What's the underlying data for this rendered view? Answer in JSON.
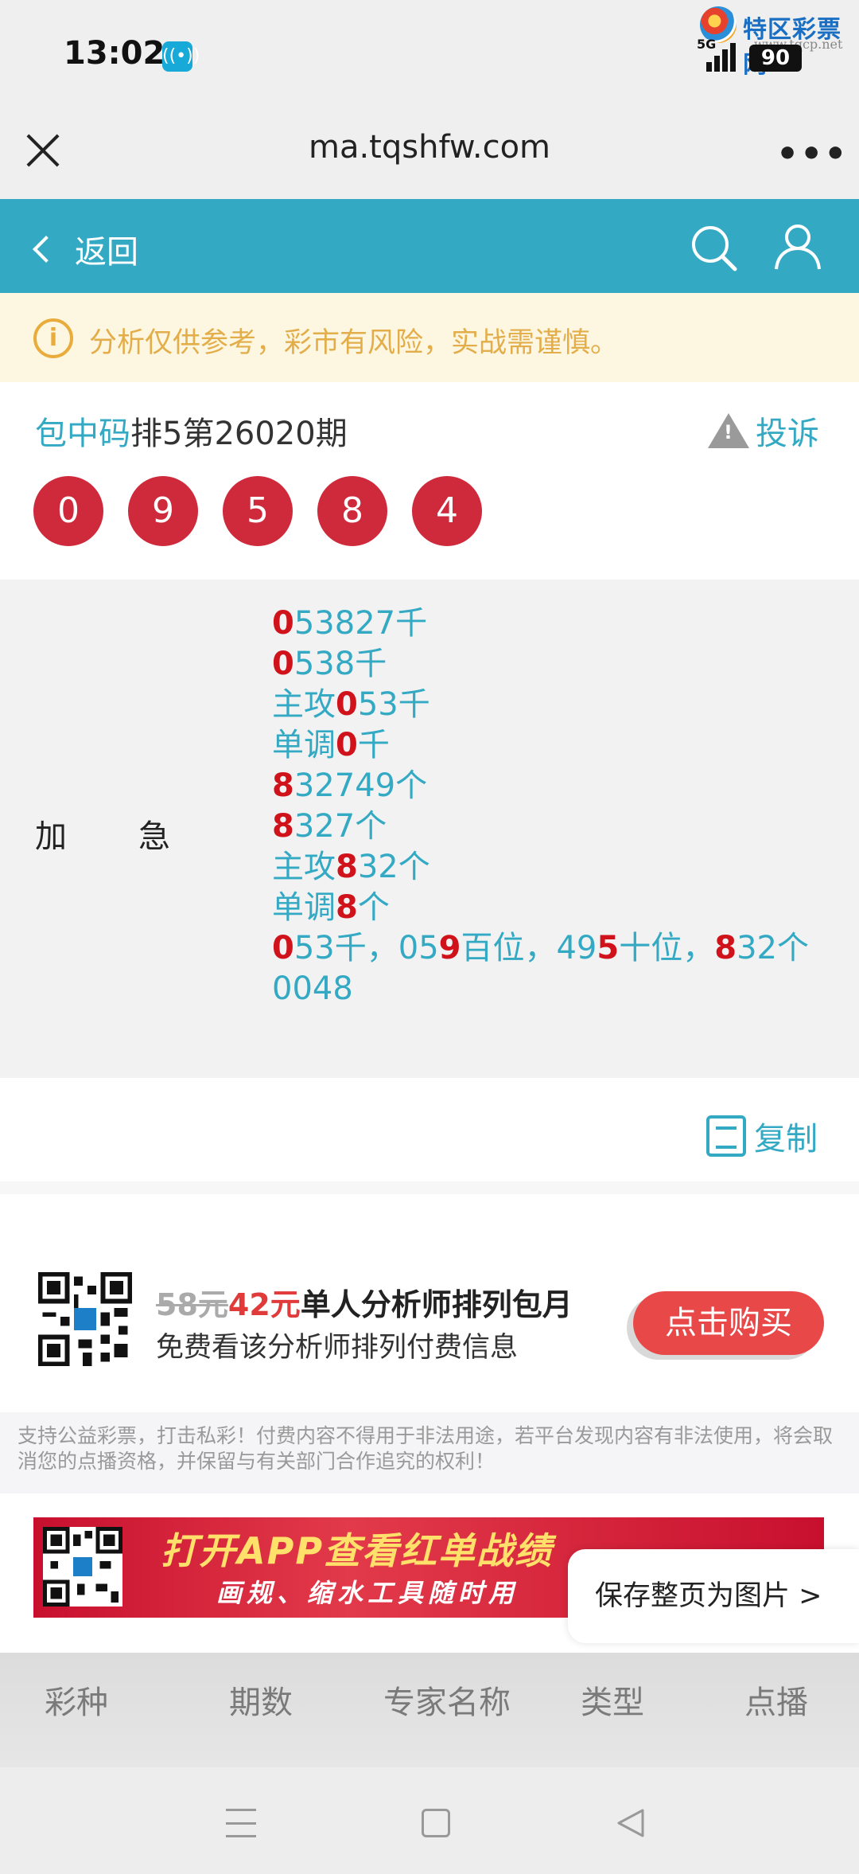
{
  "status_bar": {
    "time": "13:02",
    "network": "5G",
    "battery": "90"
  },
  "watermark": {
    "name": "特区彩票网",
    "url": "www.tqcp.net"
  },
  "browser": {
    "url": "ma.tqshfw.com"
  },
  "nav": {
    "back_label": "返回"
  },
  "notice": {
    "text": "分析仅供参考，彩市有风险，实战需谨慎。"
  },
  "title": {
    "highlight": "包中码",
    "rest": "排5第26020期",
    "complain_label": "投诉"
  },
  "numbers": [
    "0",
    "9",
    "5",
    "8",
    "4"
  ],
  "detail": {
    "label_1": "加",
    "label_2": "急",
    "lines": [
      [
        {
          "t": "0",
          "r": true
        },
        {
          "t": "53827千",
          "r": false
        }
      ],
      [
        {
          "t": "0",
          "r": true
        },
        {
          "t": "538千",
          "r": false
        }
      ],
      [
        {
          "t": "主攻",
          "r": false
        },
        {
          "t": "0",
          "r": true
        },
        {
          "t": "53千",
          "r": false
        }
      ],
      [
        {
          "t": "单调",
          "r": false
        },
        {
          "t": "0",
          "r": true
        },
        {
          "t": "千",
          "r": false
        }
      ],
      [
        {
          "t": "8",
          "r": true
        },
        {
          "t": "32749个",
          "r": false
        }
      ],
      [
        {
          "t": "8",
          "r": true
        },
        {
          "t": "327个",
          "r": false
        }
      ],
      [
        {
          "t": "主攻",
          "r": false
        },
        {
          "t": "8",
          "r": true
        },
        {
          "t": "32个",
          "r": false
        }
      ],
      [
        {
          "t": "单调",
          "r": false
        },
        {
          "t": "8",
          "r": true
        },
        {
          "t": "个",
          "r": false
        }
      ],
      [
        {
          "t": "0",
          "r": true
        },
        {
          "t": "53千，05",
          "r": false
        },
        {
          "t": "9",
          "r": true
        },
        {
          "t": "百位，49",
          "r": false
        },
        {
          "t": "5",
          "r": true
        },
        {
          "t": "十位，",
          "r": false
        },
        {
          "t": "8",
          "r": true
        },
        {
          "t": "32个",
          "r": false
        }
      ],
      [
        {
          "t": "0048",
          "r": false
        }
      ]
    ]
  },
  "copy": {
    "label": "复制"
  },
  "promo": {
    "old_price": "58元",
    "new_price": "42元",
    "title_rest": "单人分析师排列包月",
    "subtitle": "免费看该分析师排列付费信息",
    "buy_label": "点击购买"
  },
  "disclaimer": "支持公益彩票，打击私彩！付费内容不得用于非法用途，若平台发现内容有非法使用，将会取消您的点播资格，并保留与有关部门合作追究的权利！",
  "banner": {
    "line1": "打开APP查看红单战绩",
    "line2": "画规、缩水工具随时用"
  },
  "save_page": {
    "label": "保存整页为图片 >"
  },
  "table_headers": [
    "彩种",
    "期数",
    "专家名称",
    "类型",
    "点播"
  ],
  "colors": {
    "teal": "#33a9c4",
    "ball_red": "#cf2a3c",
    "accent_red": "#d0121b",
    "notice_yellow": "#e3ad4a"
  }
}
